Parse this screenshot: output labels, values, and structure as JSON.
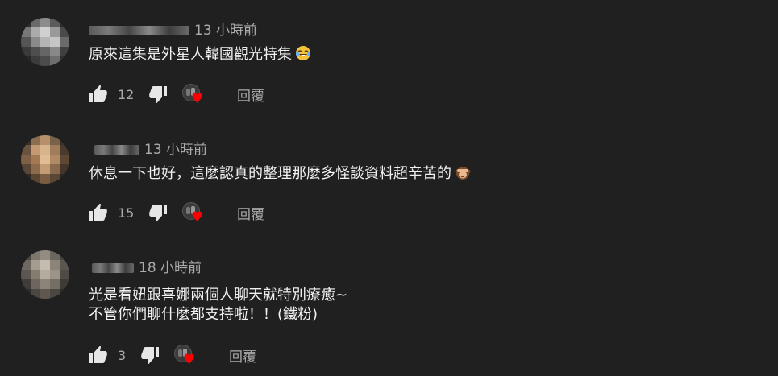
{
  "comments": [
    {
      "time": "13 小時前",
      "lines": [
        "原來這集是外星人韓國觀光特集"
      ],
      "emoji": "laughing-with-tears",
      "likes": "12",
      "reply_label": "回覆"
    },
    {
      "time": "13 小時前",
      "lines": [
        "休息一下也好，這麼認真的整理那麼多怪談資料超辛苦的"
      ],
      "emoji": "see-no-evil-monkey",
      "likes": "15",
      "reply_label": "回覆"
    },
    {
      "time": "18 小時前",
      "lines": [
        "光是看妞跟喜娜兩個人聊天就特別療癒~",
        "不管你們聊什麼都支持啦！！(鐵粉)"
      ],
      "emoji": "",
      "likes": "3",
      "reply_label": "回覆"
    }
  ],
  "colors": {
    "background": "#202020",
    "text": "#f1f1f1",
    "secondary": "#aaaaaa",
    "heart": "#ff0000"
  }
}
